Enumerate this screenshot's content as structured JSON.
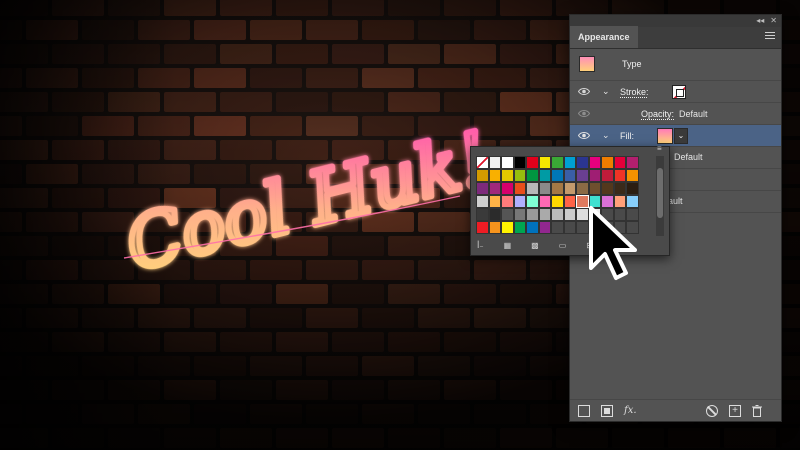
{
  "panel": {
    "tab_label": "Appearance",
    "collapse_glyph": "◂◂",
    "close_glyph": "✕",
    "rows": {
      "type_label": "Type",
      "stroke_label": "Stroke:",
      "opacity_label": "Opacity:",
      "opacity_value": "Default",
      "fill_label": "Fill:",
      "fill_sub_value": "Default",
      "fill_sub_value_2": "ault"
    },
    "footer": {
      "fx_label": "fx."
    }
  },
  "swatches": {
    "rows": [
      [
        "#ffffff",
        "#f0f0f0",
        "#ffffff",
        "#000000",
        "#e3001b",
        "#f7e600",
        "#3aa935",
        "#00a0d2",
        "#2b3590",
        "#e6007e",
        "#ef7d00",
        "#e4003a",
        "#b31f6f"
      ],
      [
        "#d49b00",
        "#f9b000",
        "#e3c800",
        "#96be0d",
        "#009640",
        "#009ba4",
        "#0077b6",
        "#3a5ea6",
        "#6a3f92",
        "#9f1e73",
        "#c01c3a",
        "#ee3426",
        "#f39200"
      ],
      [
        "#7d2a7b",
        "#a0287b",
        "#d5006c",
        "#e94e1b",
        "#b8b8b8",
        "#8a8a8a",
        "#a47845",
        "#c49a6c",
        "#8b6a45",
        "#6e4f2e",
        "#53381d",
        "#3a2a1a",
        "#2b1e12"
      ],
      [
        "#cfcfcf",
        "#ffb347",
        "#ff7b7b",
        "#b0b0ff",
        "#7fffd4",
        "#ff69b4",
        "#ffd700",
        "#ff6347",
        "#e07a5f",
        "#40e0d0",
        "#da70d6",
        "#ffa07a",
        "#87cefa"
      ],
      [
        "#3a3a3a",
        "#2b2b2b",
        "#555555",
        "#777777",
        "#999999",
        "#aaaaaa",
        "#bbbbbb",
        "#cccccc",
        "#dddddd",
        "#eeeeee",
        "#4a4a4a",
        "#4a4a4a",
        "#4a4a4a"
      ],
      [
        "#ed1c24",
        "#f7941d",
        "#fff200",
        "#00a651",
        "#0072bc",
        "#92278f",
        "#4a4a4a",
        "#4a4a4a",
        "#4a4a4a",
        "#4a4a4a",
        "#4a4a4a",
        "#4a4a4a",
        "#4a4a4a"
      ]
    ],
    "highlight_row": 3,
    "highlight_col": 8
  },
  "lettering": {
    "text": "Cool Huk!"
  },
  "colors": {
    "panel_bg": "#535353",
    "selected_row": "#4b6386",
    "gradient_top": "#ff5fb5",
    "gradient_bottom": "#ffd77a"
  },
  "icons": {
    "visibility": "eye-icon",
    "expand": "chevron-down-icon",
    "menu": "hamburger-menu-icon",
    "cursor": "arrow-cursor-icon",
    "delete": "trash-icon",
    "clear": "no-entry-icon",
    "duplicate": "duplicate-item-icon"
  }
}
